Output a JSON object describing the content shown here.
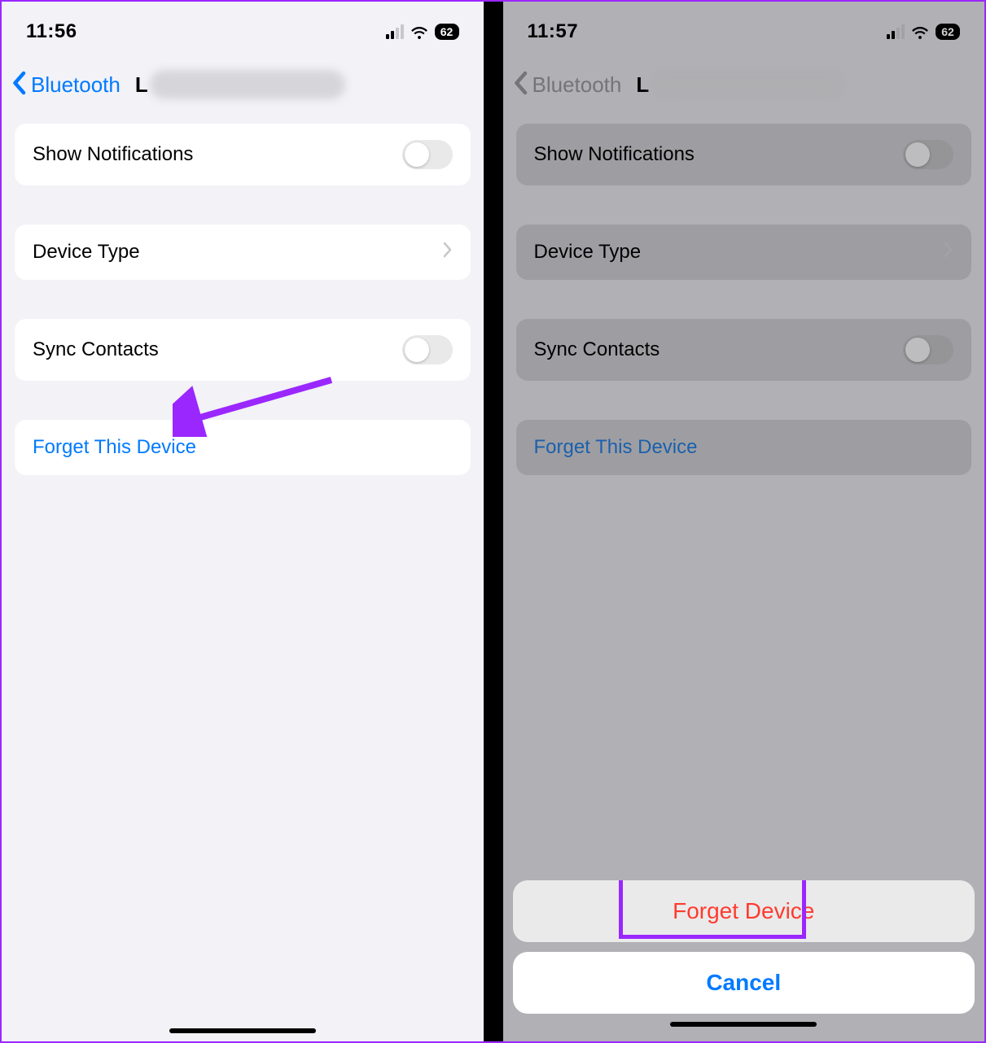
{
  "left": {
    "status": {
      "time": "11:56",
      "battery": "62"
    },
    "nav": {
      "back_label": "Bluetooth",
      "device_prefix": "L"
    },
    "rows": {
      "show_notifications": "Show Notifications",
      "device_type": "Device Type",
      "sync_contacts": "Sync Contacts",
      "forget": "Forget This Device"
    }
  },
  "right": {
    "status": {
      "time": "11:57",
      "battery": "62"
    },
    "nav": {
      "back_label": "Bluetooth",
      "device_prefix": "L"
    },
    "rows": {
      "show_notifications": "Show Notifications",
      "device_type": "Device Type",
      "sync_contacts": "Sync Contacts",
      "forget": "Forget This Device"
    },
    "sheet": {
      "forget": "Forget Device",
      "cancel": "Cancel"
    }
  },
  "colors": {
    "accent": "#007aff",
    "destructive": "#ff3b30",
    "annotation": "#9b27ff"
  }
}
